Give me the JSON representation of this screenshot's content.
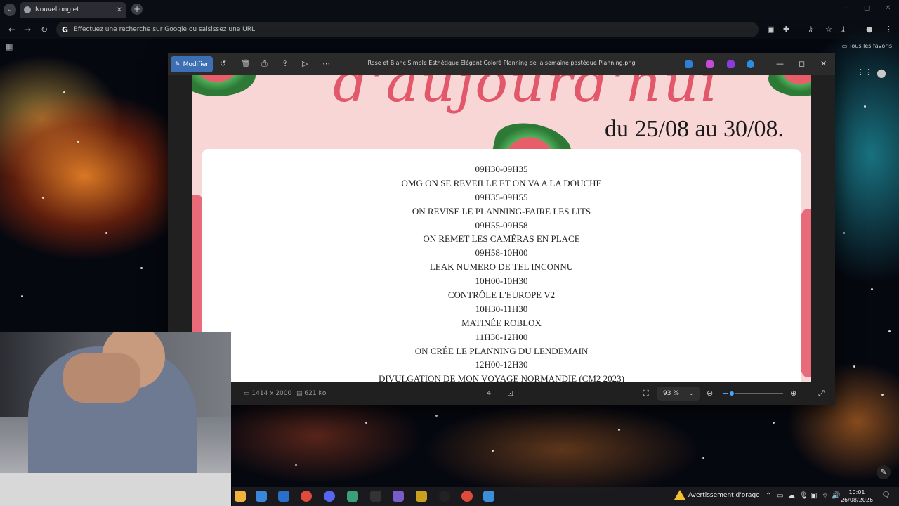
{
  "browser": {
    "tab_title": "Nouvel onglet",
    "omnibox_placeholder": "Effectuez une recherche sur Google ou saisissez une URL",
    "bookmarks_folder": "Tous les favoris"
  },
  "viewer": {
    "edit_label": "Modifier",
    "filename": "Rose et Blanc Simple Esthétique Elégant Coloré Planning de la semaine pastèque Planning.png",
    "dimensions": "1414 x 2000",
    "filesize": "621 Ko",
    "zoom": "93 %",
    "zoom_level": 0.15
  },
  "poster": {
    "title_fragment": "d'aujourd'hui",
    "date_range": "du 25/08 au 30/08.",
    "schedule": [
      "09H30-09H35",
      "OMG ON SE REVEILLE ET ON VA A LA DOUCHE",
      "09H35-09H55",
      "ON REVISE LE PLANNING-FAIRE LES LITS",
      "09H55-09H58",
      "ON REMET LES CAMÉRAS EN PLACE",
      "09H58-10H00",
      "LEAK NUMERO DE TEL INCONNU",
      "10H00-10H30",
      "CONTRÔLE L'EUROPE V2",
      "10H30-11H30",
      "MATINÉE ROBLOX",
      "11H30-12H00",
      "ON CRÉE LE PLANNING DU LENDEMAIN",
      "12H00-12H30",
      "DIVULGATION DE MON VOYAGE NORMANDIE (CM2 2023)"
    ]
  },
  "taskbar": {
    "weather_alert": "Avertissement d'orage",
    "time": "10:01",
    "date": "26/08/2026"
  },
  "colors": {
    "accent": "#3c6fb3",
    "poster_pink": "#f8d6d6",
    "script_red": "#e2576a"
  }
}
